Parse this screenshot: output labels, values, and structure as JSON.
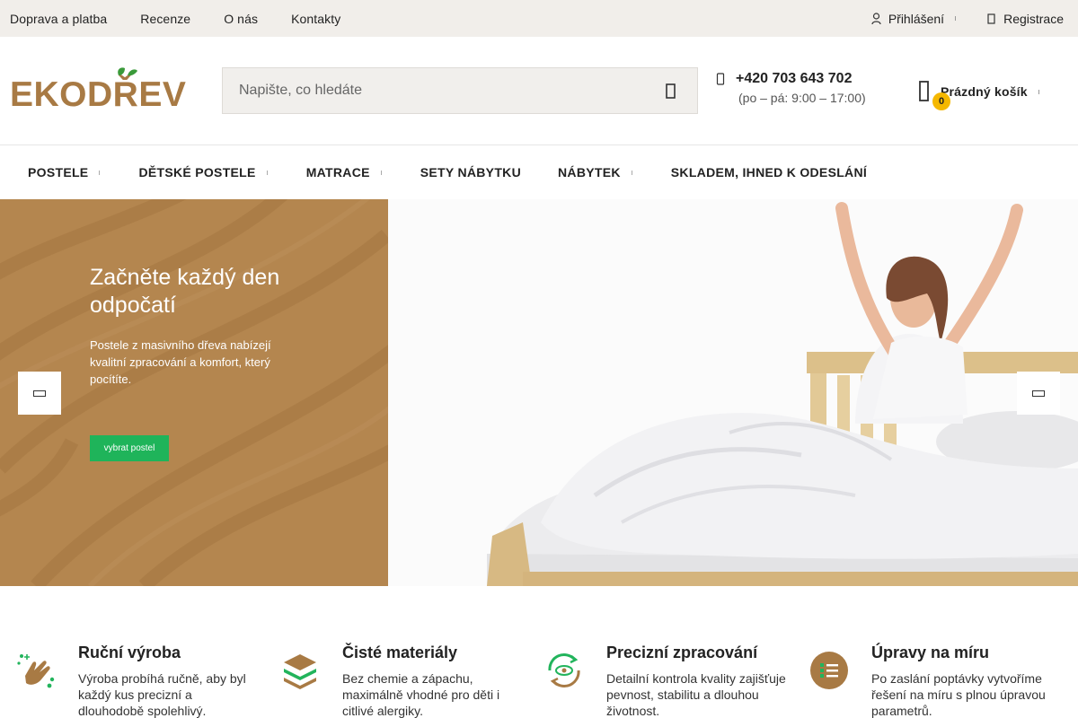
{
  "topbar": {
    "links": [
      "Doprava a platba",
      "Recenze",
      "O nás",
      "Kontakty"
    ],
    "login_label": "Přihlášení",
    "register_label": "Registrace"
  },
  "header": {
    "logo_text": "EKODŘEV",
    "search_placeholder": "Napište, co hledáte",
    "search_value": "",
    "phone": "+420 703 643 702",
    "hours": "(po – pá: 9:00 – 17:00)",
    "cart_label": "Prázdný košík",
    "cart_count": "0"
  },
  "nav": {
    "items": [
      {
        "label": "POSTELE",
        "has_dropdown": true
      },
      {
        "label": "DĚTSKÉ POSTELE",
        "has_dropdown": true
      },
      {
        "label": "MATRACE",
        "has_dropdown": true
      },
      {
        "label": "SETY NÁBYTKU",
        "has_dropdown": false
      },
      {
        "label": "NÁBYTEK",
        "has_dropdown": true
      },
      {
        "label": "SKLADEM, IHNED K ODESLÁNÍ",
        "has_dropdown": false
      }
    ]
  },
  "hero": {
    "title": "Začněte každý den odpočatí",
    "text": "Postele z masivního dřeva nabízejí kvalitní zpracování a komfort, který pocítíte.",
    "cta_label": "vybrat postel",
    "bg_color": "#b4864f",
    "cta_color": "#1fb45a"
  },
  "features": [
    {
      "icon": "handmade-icon",
      "title": "Ruční výroba",
      "desc": "Výroba probíhá ručně, aby byl každý kus precizní a dlouhodobě spolehlivý."
    },
    {
      "icon": "layers-icon",
      "title": "Čisté materiály",
      "desc": "Bez chemie a zápachu, maximálně vhodné pro děti i citlivé alergiky."
    },
    {
      "icon": "precision-icon",
      "title": "Precizní zpracování",
      "desc": "Detailní kontrola kvality zajišťuje pevnost, stabilitu a dlouhou životnost."
    },
    {
      "icon": "custom-list-icon",
      "title": "Úpravy na míru",
      "desc": "Po zaslání poptávky vytvoříme řešení na míru s plnou úpravou parametrů."
    }
  ],
  "colors": {
    "brand": "#a87a44",
    "accent_green": "#1fb45a",
    "badge": "#f5b800"
  }
}
